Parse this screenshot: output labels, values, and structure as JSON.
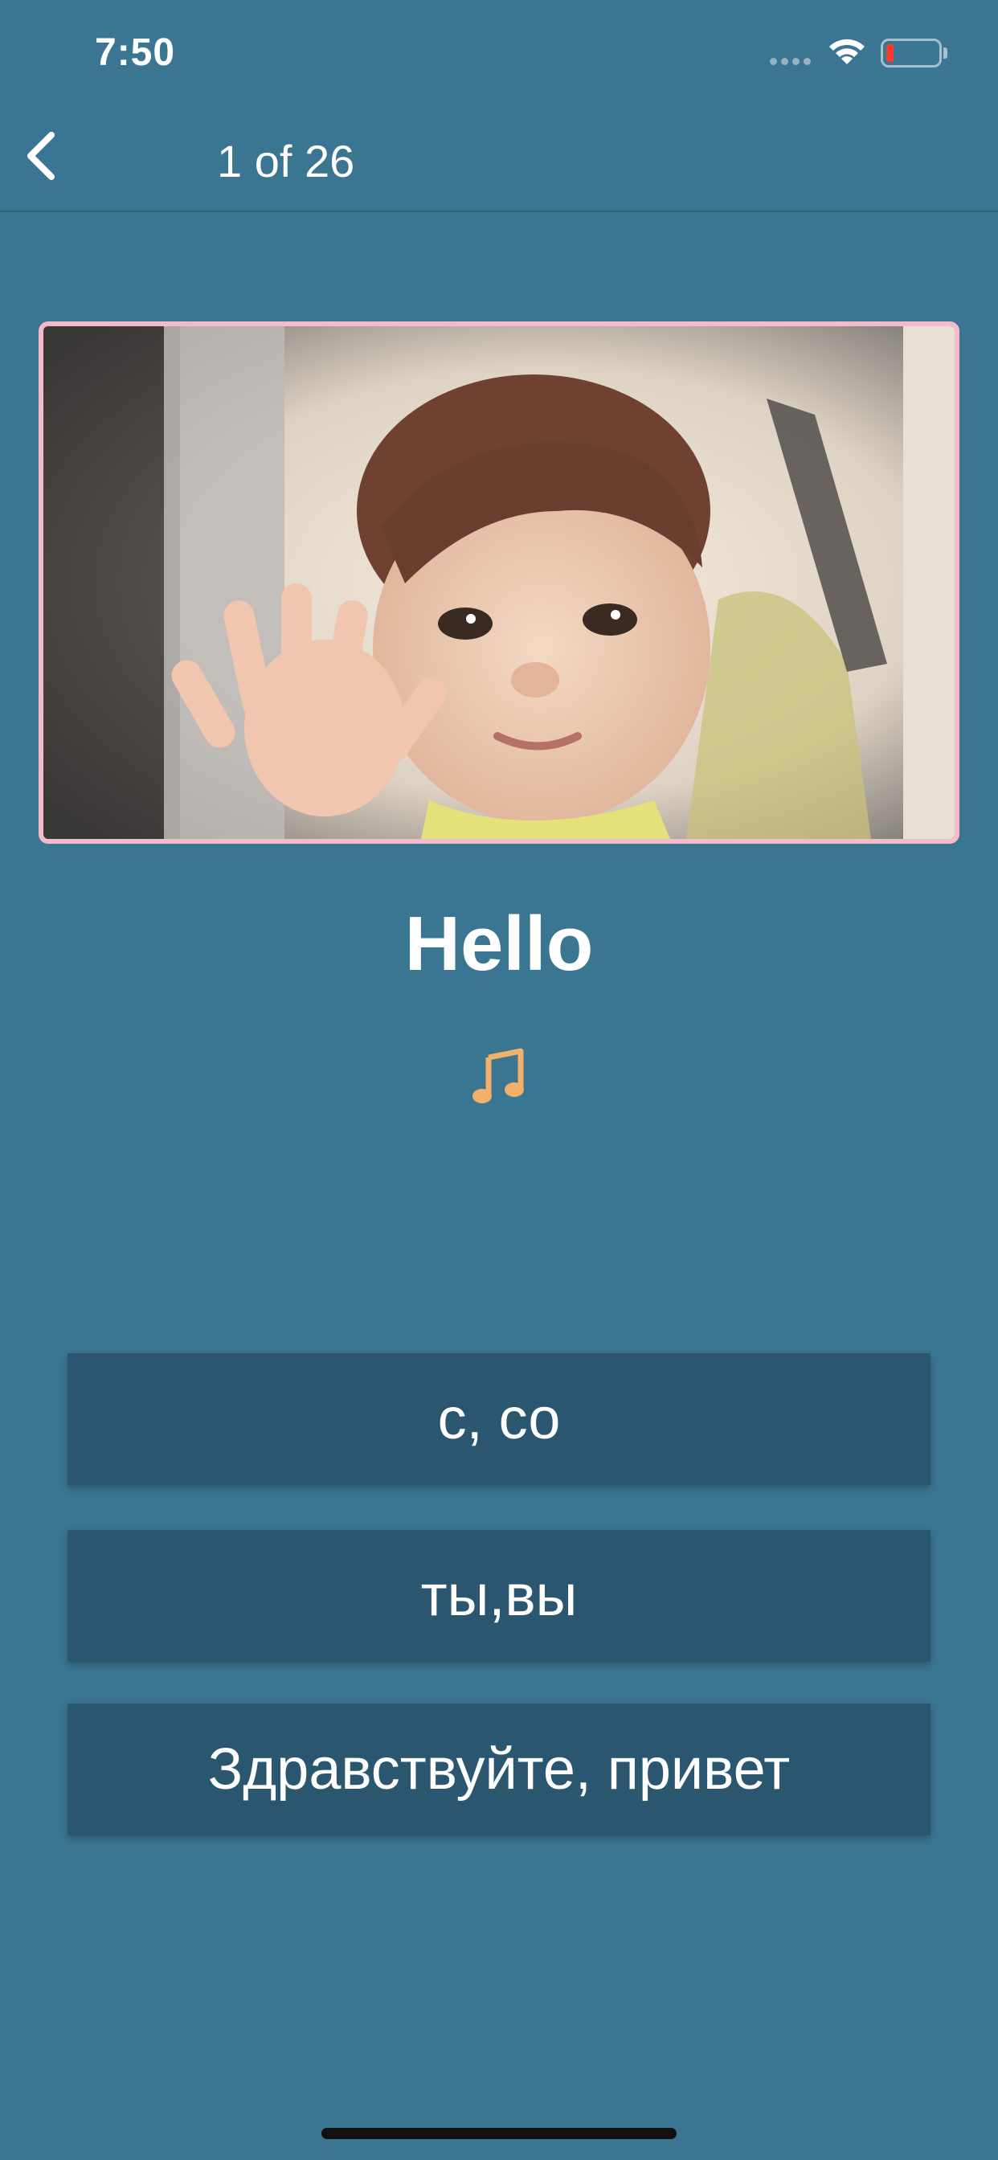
{
  "status_bar": {
    "time": "7:50"
  },
  "nav": {
    "title": "1 of 26"
  },
  "card": {
    "word": "Hello",
    "sound_glyph": "♫"
  },
  "options": [
    {
      "label": "с, со"
    },
    {
      "label": "ты,вы"
    },
    {
      "label": "Здравствуйте, привет"
    }
  ],
  "colors": {
    "background": "#3a7591",
    "option_background": "#2a576f",
    "photo_border": "#f4bccb",
    "sound_icon": "#f2b06a"
  },
  "icons": {
    "back": "chevron-left-icon",
    "sound": "music-note-icon",
    "wifi": "wifi-icon",
    "battery": "battery-icon"
  }
}
